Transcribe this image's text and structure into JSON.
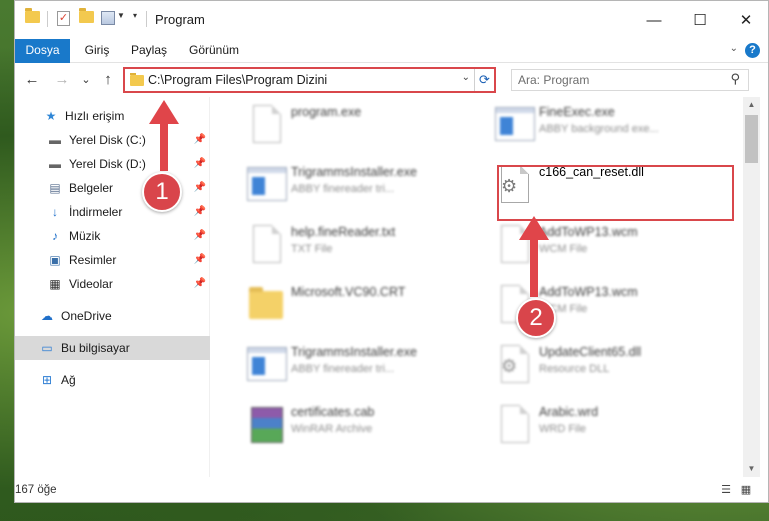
{
  "window": {
    "title": "Program",
    "controls": {
      "minimize": "—",
      "maximize": "☐",
      "close": "✕"
    }
  },
  "ribbon": {
    "tabs": [
      "Dosya",
      "Giriş",
      "Paylaş",
      "Görünüm"
    ],
    "help": "?"
  },
  "nav": {
    "back": "←",
    "forward": "→",
    "recent": "⌄",
    "up": "↑",
    "address": "C:\\Program Files\\Program Dizini",
    "refresh": "⟳",
    "search_placeholder": "Ara: Program",
    "search_icon": "⚲"
  },
  "sidebar": {
    "items": [
      {
        "label": "Hızlı erişim",
        "icon": "quick-access-icon",
        "pinned": false
      },
      {
        "label": "Yerel Disk (C:)",
        "icon": "disk-icon",
        "pinned": true
      },
      {
        "label": "Yerel Disk (D:)",
        "icon": "disk-icon",
        "pinned": true
      },
      {
        "label": "Belgeler",
        "icon": "documents-icon",
        "pinned": true
      },
      {
        "label": "İndirmeler",
        "icon": "downloads-icon",
        "pinned": true
      },
      {
        "label": "Müzik",
        "icon": "music-icon",
        "pinned": true
      },
      {
        "label": "Resimler",
        "icon": "pictures-icon",
        "pinned": true
      },
      {
        "label": "Videolar",
        "icon": "videos-icon",
        "pinned": true
      },
      {
        "label": "OneDrive",
        "icon": "onedrive-icon",
        "pinned": false
      },
      {
        "label": "Bu bilgisayar",
        "icon": "this-pc-icon",
        "pinned": false
      },
      {
        "label": "Ağ",
        "icon": "network-icon",
        "pinned": false
      }
    ]
  },
  "files": {
    "col1": [
      {
        "name": "program.exe",
        "desc": "",
        "icon": "exe-icon"
      },
      {
        "name": "TrigrammsInstaller.exe",
        "desc": "ABBY finereader tri...",
        "icon": "exe-icon"
      },
      {
        "name": "help.fineReader.txt",
        "desc": "TXT File",
        "icon": "txt-icon"
      },
      {
        "name": "Microsoft.VC90.CRT",
        "desc": "",
        "icon": "folder-icon"
      },
      {
        "name": "TrigrammsInstaller.exe",
        "desc": "ABBY finereader tri...",
        "icon": "exe-icon"
      },
      {
        "name": "certificates.cab",
        "desc": "WinRAR Archive",
        "icon": "rar-icon"
      }
    ],
    "col2": [
      {
        "name": "FineExec.exe",
        "desc": "ABBY background exe...",
        "icon": "exe-icon"
      },
      {
        "name": "c166_can_reset.dll",
        "desc": "",
        "icon": "dll-icon"
      },
      {
        "name": "AddToWP13.wcm",
        "desc": "WCM File",
        "icon": "wcm-icon"
      },
      {
        "name": "AddToWP13.wcm",
        "desc": "WCM File",
        "icon": "wcm-icon"
      },
      {
        "name": "UpdateClient65.dll",
        "desc": "Resource DLL",
        "icon": "dll-icon"
      },
      {
        "name": "Arabic.wrd",
        "desc": "WRD File",
        "icon": "wrd-icon"
      }
    ]
  },
  "status": {
    "count": "167 öğe"
  },
  "annotations": {
    "step1": "1",
    "step2": "2"
  },
  "colors": {
    "accent": "#1979ca",
    "highlight": "#d9474b",
    "arrow": "#e0454a"
  }
}
